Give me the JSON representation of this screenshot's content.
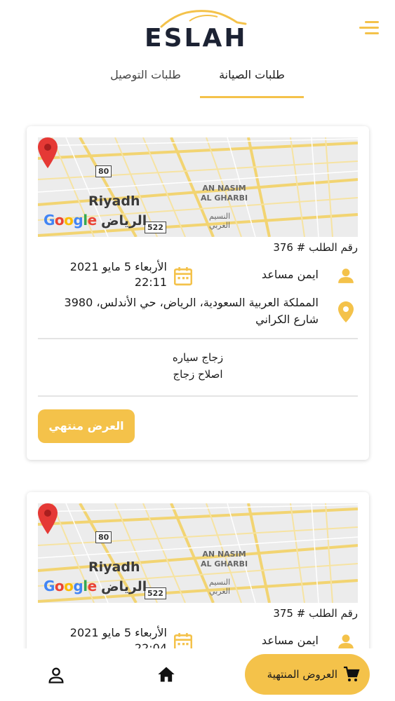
{
  "app": {
    "logo_text": "ESLAH"
  },
  "tabs": [
    {
      "label": "طلبات الصيانة",
      "active": true
    },
    {
      "label": "طلبات التوصيل",
      "active": false
    }
  ],
  "map": {
    "city_en": "Riyadh",
    "city_ar": "الرياض",
    "area_en_line1": "AN NASIM",
    "area_en_line2": "AL GHARBI",
    "area_ar_line1": "النسيم",
    "area_ar_line2": "الغربي",
    "route_80": "80",
    "route_522": "522",
    "attribution": "Google"
  },
  "orders": [
    {
      "order_number": "رقم الطلب # 376",
      "customer": "ايمن مساعد",
      "date_line1": "الأربعاء 5 مايو 2021",
      "date_line2": "22:11",
      "address_line1": "المملكة العربية السعودية، الرياض، حي الأندلس، 3980",
      "address_line2": "شارع الكراني",
      "service_line1": "زجاج سياره",
      "service_line2": "اصلاح زجاج",
      "offer_button": "العرض منتهي"
    },
    {
      "order_number": "رقم الطلب # 375",
      "customer": "ايمن مساعد",
      "date_line1": "الأربعاء 5 مايو 2021",
      "date_line2": "22:04"
    }
  ],
  "bottom_nav": {
    "finished_offers": "العروض المنتهية",
    "home_icon": "home-icon",
    "profile_icon": "profile-icon"
  },
  "colors": {
    "accent": "#f4c24a",
    "logo": "#1c2233"
  }
}
